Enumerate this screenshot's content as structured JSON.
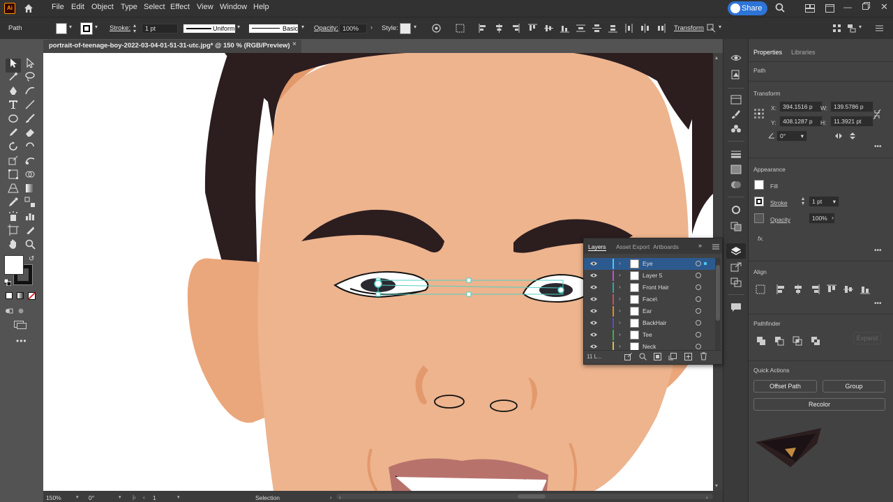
{
  "app": {
    "logo": "Ai"
  },
  "menu": [
    "File",
    "Edit",
    "Object",
    "Type",
    "Select",
    "Effect",
    "View",
    "Window",
    "Help"
  ],
  "share_label": "Share",
  "control": {
    "selection_type": "Path",
    "stroke_label": "Stroke:",
    "stroke_weight": "1 pt",
    "profile": "Uniform",
    "brush": "Basic",
    "opacity_label": "Opacity:",
    "opacity": "100%",
    "style_label": "Style:",
    "transform_label": "Transform"
  },
  "document": {
    "tab_title": "portrait-of-teenage-boy-2022-03-04-01-51-31-utc.jpg* @ 150 % (RGB/Preview)",
    "close": "×"
  },
  "properties": {
    "tabs": [
      "Properties",
      "Libraries"
    ],
    "object_type": "Path",
    "transform": {
      "title": "Transform",
      "x_label": "X:",
      "x": "394.1516 p",
      "y_label": "Y:",
      "y": "408.1287 p",
      "w_label": "W:",
      "w": "139.5786 p",
      "h_label": "H:",
      "h": "11.3921 pt",
      "angle": "0°"
    },
    "appearance": {
      "title": "Appearance",
      "fill": "Fill",
      "stroke": "Stroke",
      "stroke_weight": "1 pt",
      "opacity": "Opacity",
      "opacity_value": "100%",
      "fx": "fx."
    },
    "align_title": "Align",
    "pathfinder_title": "Pathfinder",
    "expand": "Expand",
    "quick_actions": {
      "title": "Quick Actions",
      "offset_path": "Offset Path",
      "group": "Group",
      "recolor": "Recolor"
    }
  },
  "layers_panel": {
    "tabs": [
      "Layers",
      "Asset Export",
      "Artboards"
    ],
    "layers": [
      {
        "name": "Eye",
        "color": "#4bc8f0"
      },
      {
        "name": "Layer 5",
        "color": "#c84bd2"
      },
      {
        "name": "Front Hair",
        "color": "#2aa8a0"
      },
      {
        "name": "Face\\",
        "color": "#d24b5a"
      },
      {
        "name": "Ear",
        "color": "#e08a2a"
      },
      {
        "name": "BackHair",
        "color": "#5a4bd2"
      },
      {
        "name": "Tee",
        "color": "#3ab04a"
      },
      {
        "name": "Neck",
        "color": "#d2c24b"
      }
    ],
    "count": "11 L..."
  },
  "status": {
    "zoom": "150%",
    "rotate": "0°",
    "artboard": "1",
    "tool": "Selection"
  },
  "colors": {
    "skin": "#eab38e",
    "hair": "#2c1d1f",
    "accent": "#2e74d8",
    "selection": "#4fd1c5"
  }
}
